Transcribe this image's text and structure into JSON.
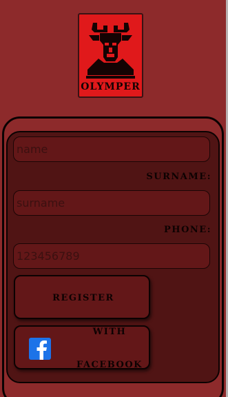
{
  "logo": {
    "text": "OLYMPER",
    "bg_color": "#e0191b",
    "icon": "bull-head-icon"
  },
  "form": {
    "name_placeholder": "name",
    "surname_label": "SURNAME:",
    "surname_placeholder": "surname",
    "phone_label": "PHONE:",
    "phone_placeholder": "123456789",
    "register_label": "REGISTER",
    "facebook_label_line1": "WITH",
    "facebook_label_line2": "FACEBOOK",
    "facebook_icon": "facebook-icon"
  },
  "colors": {
    "page_bg": "#8d2a2b",
    "inner_panel": "#501414",
    "field_bg": "#631718",
    "facebook_blue": "#1d73e8"
  }
}
